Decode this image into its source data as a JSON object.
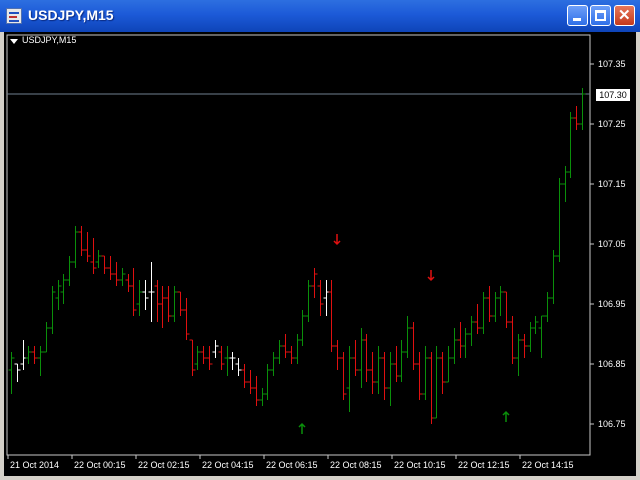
{
  "window": {
    "title": "USDJPY,M15",
    "icon": "chart-window-icon"
  },
  "chart_header": {
    "label": "USDJPY,M15"
  },
  "current_price": "107.30",
  "colors": {
    "bull": "#0a8f0a",
    "bear": "#e01010",
    "neutral": "#ffffff",
    "grid": "#c8c8c8",
    "price_line": "#708090"
  },
  "chart_data": {
    "type": "bar",
    "title": "",
    "ylim": [
      106.7,
      107.38
    ],
    "y_ticks": [
      "107.35",
      "107.25",
      "107.15",
      "107.05",
      "106.95",
      "106.85",
      "106.75"
    ],
    "y_tick_values": [
      107.35,
      107.25,
      107.15,
      107.05,
      106.95,
      106.85,
      106.75
    ],
    "x_ticks": [
      "21 Oct 2014",
      "22 Oct 00:15",
      "22 Oct 02:15",
      "22 Oct 04:15",
      "22 Oct 06:15",
      "22 Oct 08:15",
      "22 Oct 10:15",
      "22 Oct 12:15",
      "22 Oct 14:15"
    ],
    "current_price": 107.3,
    "bars": [
      {
        "o": 106.84,
        "h": 106.87,
        "l": 106.8,
        "c": 106.86,
        "d": "bull"
      },
      {
        "o": 106.85,
        "h": 106.85,
        "l": 106.82,
        "c": 106.84,
        "d": "neutral"
      },
      {
        "o": 106.85,
        "h": 106.89,
        "l": 106.84,
        "c": 106.86,
        "d": "neutral"
      },
      {
        "o": 106.86,
        "h": 106.88,
        "l": 106.85,
        "c": 106.87,
        "d": "bull"
      },
      {
        "o": 106.87,
        "h": 106.88,
        "l": 106.85,
        "c": 106.86,
        "d": "bear"
      },
      {
        "o": 106.86,
        "h": 106.88,
        "l": 106.83,
        "c": 106.87,
        "d": "bull"
      },
      {
        "o": 106.87,
        "h": 106.92,
        "l": 106.87,
        "c": 106.91,
        "d": "bull"
      },
      {
        "o": 106.91,
        "h": 106.98,
        "l": 106.9,
        "c": 106.97,
        "d": "bull"
      },
      {
        "o": 106.96,
        "h": 106.99,
        "l": 106.94,
        "c": 106.98,
        "d": "bull"
      },
      {
        "o": 106.97,
        "h": 107.0,
        "l": 106.95,
        "c": 106.99,
        "d": "bull"
      },
      {
        "o": 106.99,
        "h": 107.03,
        "l": 106.98,
        "c": 107.02,
        "d": "bull"
      },
      {
        "o": 107.02,
        "h": 107.08,
        "l": 107.01,
        "c": 107.07,
        "d": "bull"
      },
      {
        "o": 107.07,
        "h": 107.08,
        "l": 107.03,
        "c": 107.04,
        "d": "bear"
      },
      {
        "o": 107.04,
        "h": 107.07,
        "l": 107.02,
        "c": 107.03,
        "d": "bear"
      },
      {
        "o": 107.02,
        "h": 107.06,
        "l": 107.0,
        "c": 107.01,
        "d": "bear"
      },
      {
        "o": 107.02,
        "h": 107.04,
        "l": 107.01,
        "c": 107.03,
        "d": "bull"
      },
      {
        "o": 107.03,
        "h": 107.03,
        "l": 107.0,
        "c": 107.01,
        "d": "bear"
      },
      {
        "o": 107.01,
        "h": 107.03,
        "l": 106.99,
        "c": 107.0,
        "d": "bear"
      },
      {
        "o": 107.0,
        "h": 107.02,
        "l": 106.98,
        "c": 106.99,
        "d": "bear"
      },
      {
        "o": 106.99,
        "h": 107.01,
        "l": 106.98,
        "c": 107.0,
        "d": "bull"
      },
      {
        "o": 106.99,
        "h": 107.0,
        "l": 106.97,
        "c": 106.98,
        "d": "bear"
      },
      {
        "o": 106.98,
        "h": 107.01,
        "l": 106.93,
        "c": 106.94,
        "d": "bear"
      },
      {
        "o": 106.95,
        "h": 106.99,
        "l": 106.93,
        "c": 106.97,
        "d": "bull"
      },
      {
        "o": 106.97,
        "h": 106.99,
        "l": 106.94,
        "c": 106.96,
        "d": "neutral"
      },
      {
        "o": 106.97,
        "h": 107.02,
        "l": 106.92,
        "c": 106.97,
        "d": "neutral"
      },
      {
        "o": 106.98,
        "h": 106.99,
        "l": 106.92,
        "c": 106.95,
        "d": "bear"
      },
      {
        "o": 106.95,
        "h": 106.98,
        "l": 106.91,
        "c": 106.96,
        "d": "bear"
      },
      {
        "o": 106.96,
        "h": 106.98,
        "l": 106.92,
        "c": 106.93,
        "d": "bear"
      },
      {
        "o": 106.93,
        "h": 106.98,
        "l": 106.92,
        "c": 106.97,
        "d": "bull"
      },
      {
        "o": 106.97,
        "h": 106.97,
        "l": 106.93,
        "c": 106.94,
        "d": "bear"
      },
      {
        "o": 106.94,
        "h": 106.96,
        "l": 106.89,
        "c": 106.9,
        "d": "bear"
      },
      {
        "o": 106.89,
        "h": 106.89,
        "l": 106.83,
        "c": 106.84,
        "d": "bear"
      },
      {
        "o": 106.85,
        "h": 106.88,
        "l": 106.84,
        "c": 106.87,
        "d": "bull"
      },
      {
        "o": 106.87,
        "h": 106.88,
        "l": 106.85,
        "c": 106.86,
        "d": "bear"
      },
      {
        "o": 106.86,
        "h": 106.88,
        "l": 106.84,
        "c": 106.85,
        "d": "bear"
      },
      {
        "o": 106.87,
        "h": 106.89,
        "l": 106.86,
        "c": 106.88,
        "d": "neutral"
      },
      {
        "o": 106.87,
        "h": 106.88,
        "l": 106.84,
        "c": 106.85,
        "d": "bear"
      },
      {
        "o": 106.86,
        "h": 106.88,
        "l": 106.83,
        "c": 106.86,
        "d": "bull"
      },
      {
        "o": 106.86,
        "h": 106.87,
        "l": 106.84,
        "c": 106.86,
        "d": "neutral"
      },
      {
        "o": 106.85,
        "h": 106.86,
        "l": 106.83,
        "c": 106.84,
        "d": "neutral"
      },
      {
        "o": 106.84,
        "h": 106.85,
        "l": 106.81,
        "c": 106.82,
        "d": "bear"
      },
      {
        "o": 106.82,
        "h": 106.84,
        "l": 106.8,
        "c": 106.81,
        "d": "bear"
      },
      {
        "o": 106.81,
        "h": 106.83,
        "l": 106.78,
        "c": 106.79,
        "d": "bear"
      },
      {
        "o": 106.79,
        "h": 106.81,
        "l": 106.78,
        "c": 106.8,
        "d": "bull"
      },
      {
        "o": 106.8,
        "h": 106.85,
        "l": 106.79,
        "c": 106.84,
        "d": "bull"
      },
      {
        "o": 106.84,
        "h": 106.87,
        "l": 106.83,
        "c": 106.86,
        "d": "bull"
      },
      {
        "o": 106.86,
        "h": 106.89,
        "l": 106.85,
        "c": 106.88,
        "d": "bull"
      },
      {
        "o": 106.88,
        "h": 106.9,
        "l": 106.86,
        "c": 106.87,
        "d": "bear"
      },
      {
        "o": 106.87,
        "h": 106.88,
        "l": 106.85,
        "c": 106.86,
        "d": "bear"
      },
      {
        "o": 106.86,
        "h": 106.9,
        "l": 106.85,
        "c": 106.89,
        "d": "bull"
      },
      {
        "o": 106.89,
        "h": 106.94,
        "l": 106.88,
        "c": 106.93,
        "d": "bull"
      },
      {
        "o": 106.93,
        "h": 106.99,
        "l": 106.92,
        "c": 106.98,
        "d": "bull"
      },
      {
        "o": 106.98,
        "h": 107.01,
        "l": 106.96,
        "c": 107.0,
        "d": "bear"
      },
      {
        "o": 106.98,
        "h": 106.99,
        "l": 106.93,
        "c": 106.95,
        "d": "bear"
      },
      {
        "o": 106.96,
        "h": 106.99,
        "l": 106.93,
        "c": 106.97,
        "d": "neutral"
      },
      {
        "o": 106.97,
        "h": 106.99,
        "l": 106.87,
        "c": 106.88,
        "d": "bear"
      },
      {
        "o": 106.88,
        "h": 106.89,
        "l": 106.84,
        "c": 106.86,
        "d": "bear"
      },
      {
        "o": 106.86,
        "h": 106.87,
        "l": 106.79,
        "c": 106.8,
        "d": "bear"
      },
      {
        "o": 106.81,
        "h": 106.88,
        "l": 106.77,
        "c": 106.86,
        "d": "bull"
      },
      {
        "o": 106.86,
        "h": 106.89,
        "l": 106.83,
        "c": 106.84,
        "d": "bear"
      },
      {
        "o": 106.84,
        "h": 106.91,
        "l": 106.81,
        "c": 106.89,
        "d": "bull"
      },
      {
        "o": 106.89,
        "h": 106.9,
        "l": 106.82,
        "c": 106.84,
        "d": "bear"
      },
      {
        "o": 106.84,
        "h": 106.87,
        "l": 106.8,
        "c": 106.82,
        "d": "bear"
      },
      {
        "o": 106.82,
        "h": 106.88,
        "l": 106.8,
        "c": 106.86,
        "d": "bull"
      },
      {
        "o": 106.86,
        "h": 106.87,
        "l": 106.79,
        "c": 106.81,
        "d": "bear"
      },
      {
        "o": 106.81,
        "h": 106.87,
        "l": 106.78,
        "c": 106.85,
        "d": "bull"
      },
      {
        "o": 106.85,
        "h": 106.88,
        "l": 106.82,
        "c": 106.83,
        "d": "bear"
      },
      {
        "o": 106.83,
        "h": 106.89,
        "l": 106.82,
        "c": 106.87,
        "d": "bull"
      },
      {
        "o": 106.87,
        "h": 106.93,
        "l": 106.86,
        "c": 106.91,
        "d": "bull"
      },
      {
        "o": 106.91,
        "h": 106.92,
        "l": 106.84,
        "c": 106.85,
        "d": "bear"
      },
      {
        "o": 106.85,
        "h": 106.87,
        "l": 106.79,
        "c": 106.8,
        "d": "bear"
      },
      {
        "o": 106.8,
        "h": 106.88,
        "l": 106.79,
        "c": 106.86,
        "d": "bull"
      },
      {
        "o": 106.86,
        "h": 106.87,
        "l": 106.75,
        "c": 106.76,
        "d": "bear"
      },
      {
        "o": 106.76,
        "h": 106.88,
        "l": 106.76,
        "c": 106.86,
        "d": "bull"
      },
      {
        "o": 106.86,
        "h": 106.87,
        "l": 106.8,
        "c": 106.82,
        "d": "bear"
      },
      {
        "o": 106.82,
        "h": 106.88,
        "l": 106.82,
        "c": 106.86,
        "d": "bull"
      },
      {
        "o": 106.86,
        "h": 106.91,
        "l": 106.85,
        "c": 106.89,
        "d": "bull"
      },
      {
        "o": 106.89,
        "h": 106.92,
        "l": 106.86,
        "c": 106.88,
        "d": "bear"
      },
      {
        "o": 106.88,
        "h": 106.91,
        "l": 106.86,
        "c": 106.9,
        "d": "bull"
      },
      {
        "o": 106.9,
        "h": 106.93,
        "l": 106.88,
        "c": 106.92,
        "d": "bull"
      },
      {
        "o": 106.92,
        "h": 106.95,
        "l": 106.9,
        "c": 106.91,
        "d": "bear"
      },
      {
        "o": 106.91,
        "h": 106.97,
        "l": 106.9,
        "c": 106.96,
        "d": "bull"
      },
      {
        "o": 106.96,
        "h": 106.98,
        "l": 106.92,
        "c": 106.93,
        "d": "bear"
      },
      {
        "o": 106.93,
        "h": 106.97,
        "l": 106.92,
        "c": 106.96,
        "d": "bull"
      },
      {
        "o": 106.96,
        "h": 106.98,
        "l": 106.93,
        "c": 106.97,
        "d": "bull"
      },
      {
        "o": 106.97,
        "h": 106.97,
        "l": 106.91,
        "c": 106.92,
        "d": "bear"
      },
      {
        "o": 106.92,
        "h": 106.93,
        "l": 106.85,
        "c": 106.86,
        "d": "bear"
      },
      {
        "o": 106.86,
        "h": 106.9,
        "l": 106.83,
        "c": 106.89,
        "d": "bull"
      },
      {
        "o": 106.89,
        "h": 106.9,
        "l": 106.86,
        "c": 106.88,
        "d": "bear"
      },
      {
        "o": 106.88,
        "h": 106.92,
        "l": 106.87,
        "c": 106.91,
        "d": "bull"
      },
      {
        "o": 106.91,
        "h": 106.93,
        "l": 106.9,
        "c": 106.92,
        "d": "bull"
      },
      {
        "o": 106.91,
        "h": 106.93,
        "l": 106.86,
        "c": 106.93,
        "d": "bull"
      },
      {
        "o": 106.93,
        "h": 106.97,
        "l": 106.92,
        "c": 106.96,
        "d": "bull"
      },
      {
        "o": 106.96,
        "h": 107.04,
        "l": 106.95,
        "c": 107.03,
        "d": "bull"
      },
      {
        "o": 107.03,
        "h": 107.16,
        "l": 107.02,
        "c": 107.15,
        "d": "bull"
      },
      {
        "o": 107.15,
        "h": 107.18,
        "l": 107.12,
        "c": 107.17,
        "d": "bull"
      },
      {
        "o": 107.17,
        "h": 107.27,
        "l": 107.16,
        "c": 107.26,
        "d": "bull"
      },
      {
        "o": 107.26,
        "h": 107.28,
        "l": 107.24,
        "c": 107.25,
        "d": "bear"
      },
      {
        "o": 107.25,
        "h": 107.31,
        "l": 107.24,
        "c": 107.3,
        "d": "bull"
      }
    ],
    "signals": [
      {
        "bar": 50,
        "type": "buy",
        "price": 106.74
      },
      {
        "bar": 56,
        "type": "sell",
        "price": 107.06
      },
      {
        "bar": 72,
        "type": "sell",
        "price": 107.0
      },
      {
        "bar": 85,
        "type": "buy",
        "price": 106.76
      }
    ]
  }
}
